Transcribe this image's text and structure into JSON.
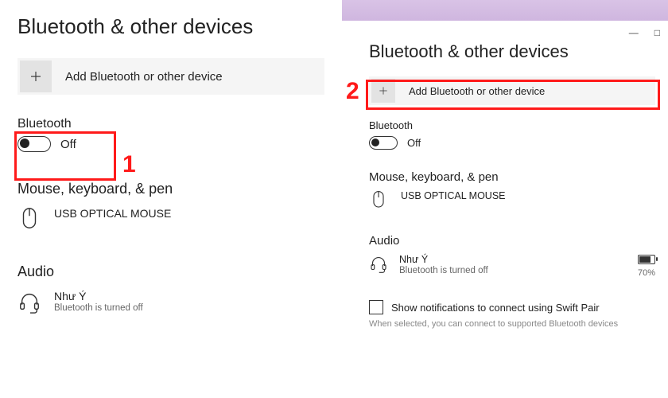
{
  "annotations": {
    "step1": "1",
    "step2": "2"
  },
  "left": {
    "title": "Bluetooth & other devices",
    "add_label": "Add Bluetooth or other device",
    "bt_label": "Bluetooth",
    "bt_state": "Off",
    "section_mouse": "Mouse, keyboard, & pen",
    "device_mouse": "USB OPTICAL MOUSE",
    "section_audio": "Audio",
    "audio_device": "Như Ý",
    "audio_sub": "Bluetooth is turned off"
  },
  "right": {
    "title": "Bluetooth & other devices",
    "add_label": "Add Bluetooth or other device",
    "bt_label": "Bluetooth",
    "bt_state": "Off",
    "section_mouse": "Mouse, keyboard, & pen",
    "device_mouse": "USB OPTICAL MOUSE",
    "section_audio": "Audio",
    "audio_device": "Như Ý",
    "audio_sub": "Bluetooth is turned off",
    "battery_pct": "70%",
    "swift_pair_label": "Show notifications to connect using Swift Pair",
    "swift_pair_hint": "When selected, you can connect to supported Bluetooth devices"
  },
  "win_controls": {
    "minimize": "—",
    "maximize": "□"
  }
}
